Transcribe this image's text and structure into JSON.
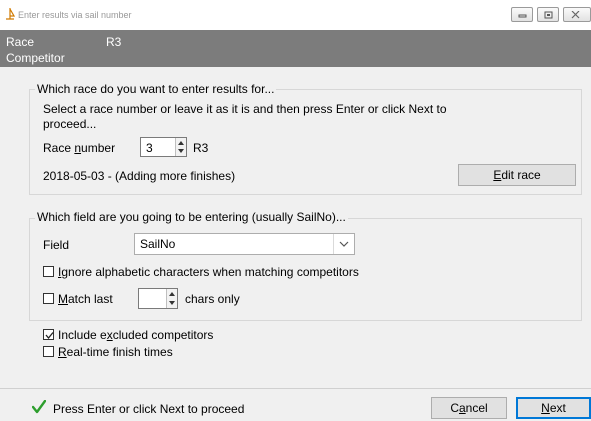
{
  "window": {
    "title": "Enter results via sail number"
  },
  "header": {
    "race_label": "Race",
    "race_value": "R3",
    "competitor_label": "Competitor"
  },
  "race_group": {
    "title": "Which race do you want to enter results for...",
    "instruction_line1": "Select a race number or leave it as it is and then press Enter or click Next to",
    "instruction_line2": "proceed...",
    "race_number_label_pre": "Race ",
    "race_number_label_u": "n",
    "race_number_label_post": "umber",
    "race_number_value": "3",
    "race_code": "R3",
    "race_info": "2018-05-03 - (Adding more finishes)",
    "edit_race_u": "E",
    "edit_race_rest": "dit race"
  },
  "field_group": {
    "title": "Which field are you going to be entering (usually SailNo)...",
    "field_label": "Field",
    "field_value": "SailNo",
    "ignore_u": "I",
    "ignore_rest": "gnore alphabetic characters when matching competitors",
    "ignore_checked": false,
    "match_u": "M",
    "match_rest": "atch last",
    "match_checked": false,
    "match_value": "",
    "chars_only": "chars only"
  },
  "options": {
    "include_pre": "Include e",
    "include_u": "x",
    "include_post": "cluded competitors",
    "include_checked": true,
    "realtime_u": "R",
    "realtime_rest": "eal-time finish times",
    "realtime_checked": false
  },
  "footer": {
    "status_text": "Press Enter or click Next to proceed",
    "cancel_pre": "C",
    "cancel_u": "a",
    "cancel_post": "ncel",
    "next_u": "N",
    "next_rest": "ext",
    "status_icon_color": "#2e9e2e"
  }
}
